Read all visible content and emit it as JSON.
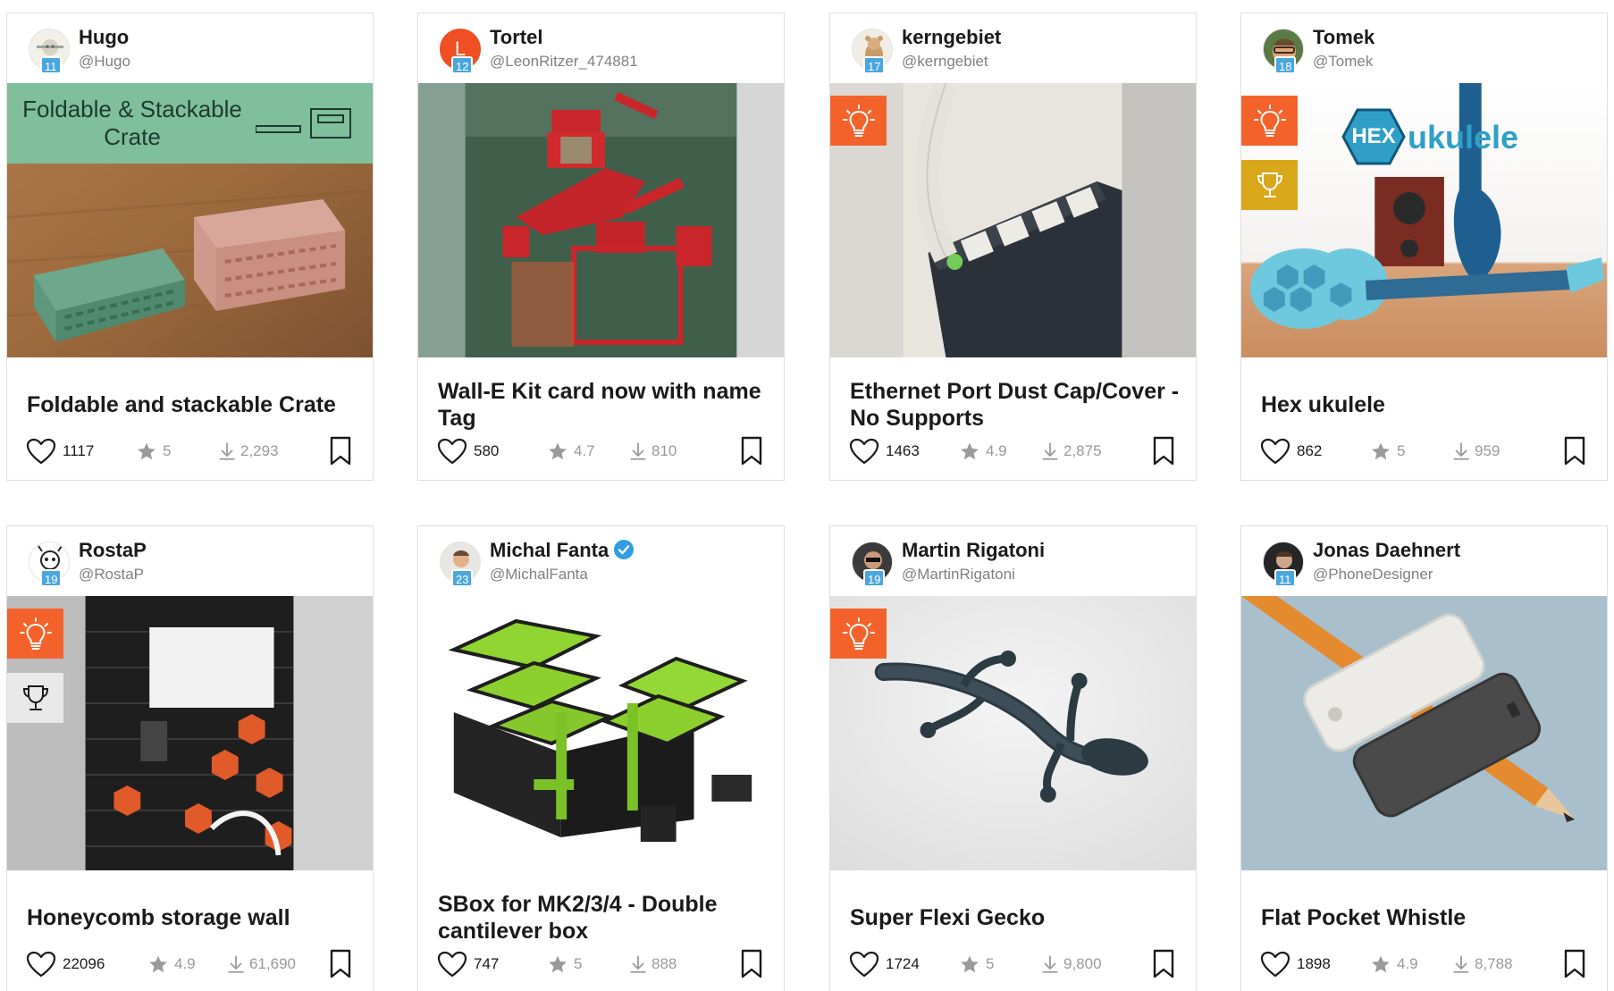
{
  "colors": {
    "accent_idea": "#f4622c",
    "trophy_gold": "#d8a71a",
    "level_badge": "#4aa6dd",
    "verified": "#2f9de0"
  },
  "cards": [
    {
      "user": {
        "name": "Hugo",
        "handle": "@Hugo",
        "level": "11"
      },
      "image_banner_text": "Foldable & Stackable Crate",
      "title": "Foldable and stackable Crate",
      "likes": "1117",
      "rating": "5",
      "downloads": "2,293",
      "icons": [
        "heart-icon",
        "star-icon",
        "download-icon",
        "bookmark-icon"
      ]
    },
    {
      "user": {
        "name": "Tortel",
        "handle": "@LeonRitzer_474881",
        "level": "12",
        "avatar_letter": "L"
      },
      "title": "Wall-E Kit card now with name Tag",
      "likes": "580",
      "rating": "4.7",
      "downloads": "810"
    },
    {
      "user": {
        "name": "kerngebiet",
        "handle": "@kerngebiet",
        "level": "17"
      },
      "title": "Ethernet Port Dust Cap/Cover - No Supports",
      "likes": "1463",
      "rating": "4.9",
      "downloads": "2,875",
      "badges": [
        "idea-bulb-icon"
      ]
    },
    {
      "user": {
        "name": "Tomek",
        "handle": "@Tomek",
        "level": "18"
      },
      "image_logo_text": {
        "hex": "HEX",
        "word": "ukulele"
      },
      "title": "Hex ukulele",
      "likes": "862",
      "rating": "5",
      "downloads": "959",
      "badges": [
        "idea-bulb-icon",
        "trophy-icon"
      ]
    },
    {
      "user": {
        "name": "RostaP",
        "handle": "@RostaP",
        "level": "19"
      },
      "title": "Honeycomb storage wall",
      "likes": "22096",
      "rating": "4.9",
      "downloads": "61,690",
      "badges": [
        "idea-bulb-icon",
        "trophy-icon"
      ]
    },
    {
      "user": {
        "name": "Michal Fanta",
        "handle": "@MichalFanta",
        "level": "23",
        "verified": true
      },
      "title": "SBox for MK2/3/4 - Double cantilever box",
      "likes": "747",
      "rating": "5",
      "downloads": "888"
    },
    {
      "user": {
        "name": "Martin Rigatoni",
        "handle": "@MartinRigatoni",
        "level": "19"
      },
      "title": "Super Flexi Gecko",
      "likes": "1724",
      "rating": "5",
      "downloads": "9,800",
      "badges": [
        "idea-bulb-icon"
      ]
    },
    {
      "user": {
        "name": "Jonas Daehnert",
        "handle": "@PhoneDesigner",
        "level": "11"
      },
      "title": "Flat Pocket Whistle",
      "likes": "1898",
      "rating": "4.9",
      "downloads": "8,788"
    }
  ]
}
